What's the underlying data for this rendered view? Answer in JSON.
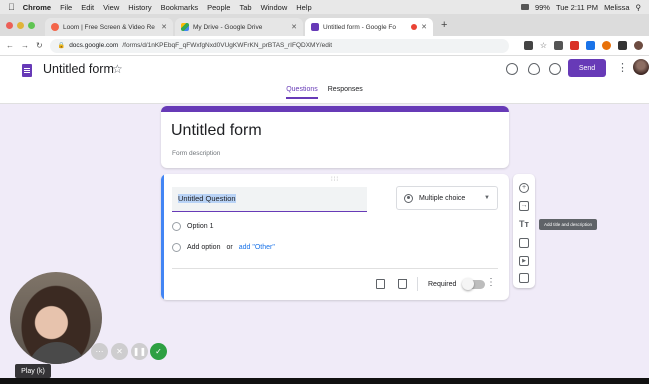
{
  "mac_menubar": {
    "app": "Chrome",
    "items": [
      "File",
      "Edit",
      "View",
      "History",
      "Bookmarks",
      "People",
      "Tab",
      "Window",
      "Help"
    ],
    "battery": "99%",
    "clock": "Tue 2:11 PM",
    "user": "Melissa"
  },
  "browser": {
    "tabs": [
      {
        "label": "Loom | Free Screen & Video Re",
        "favicon_color": "#f3654a"
      },
      {
        "label": "My Drive - Google Drive",
        "favicon_color": "#fbbc04"
      },
      {
        "label": "Untitled form - Google Fo",
        "favicon_color": "#673ab7"
      }
    ],
    "new_tab_label": "+",
    "url_host": "docs.google.com",
    "url_path": "/forms/d/1nKPEbqF_qFWxfgNxd0VUgKWFrKN_prBTAS_rIFQDXMY/edit"
  },
  "forms_header": {
    "title": "Untitled form",
    "send_label": "Send",
    "tabs": [
      "Questions",
      "Responses"
    ]
  },
  "form": {
    "title": "Untitled form",
    "description_placeholder": "Form description"
  },
  "question": {
    "title": "Untitled Question",
    "type": "Multiple choice",
    "option1": "Option 1",
    "add_option": "Add option",
    "or_word": "or",
    "add_other": "add \"Other\"",
    "required_label": "Required"
  },
  "side_toolbar": {
    "tooltip": "Add title and description",
    "title_icon_glyph": "Tт"
  },
  "recorder": {
    "play_tooltip": "Play (k)"
  },
  "colors": {
    "accent": "#673ab7",
    "question_accent": "#4285f4",
    "background": "#f0ebf8"
  }
}
